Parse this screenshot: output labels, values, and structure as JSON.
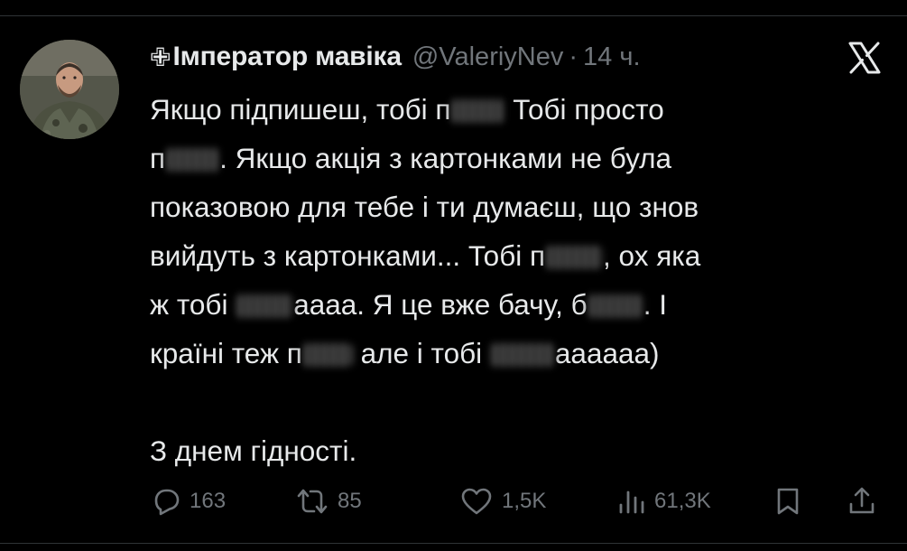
{
  "author": {
    "display_name": "Імператор мавіка",
    "badge_icon": "cross-icon",
    "handle": "@ValeriyNev",
    "separator": "·",
    "time": "14 ч."
  },
  "platform_logo": "x-logo-icon",
  "tweet": {
    "lines": [
      [
        "Якщо підпишеш, тобі п",
        "[blur]",
        " Тобі просто"
      ],
      [
        "п",
        "[blur]",
        ". Якщо акція з картонками не була"
      ],
      [
        "показовою для тебе і ти думаєш, що знов"
      ],
      [
        "вийдуть з картонками... Тобі п",
        "[blur]",
        ", ох яка"
      ],
      [
        "ж тобі ",
        "[blur]",
        "аааа. Я це вже бачу, б",
        "[blur]",
        ". І"
      ],
      [
        "країні теж п",
        "[blur]",
        " але і тобі ",
        "[blur]",
        "аааааа)"
      ],
      [],
      [
        "З днем гідності."
      ]
    ]
  },
  "actions": {
    "replies": {
      "icon": "reply-icon",
      "count": "163"
    },
    "reposts": {
      "icon": "repost-icon",
      "count": "85"
    },
    "likes": {
      "icon": "like-icon",
      "count": "1,5K"
    },
    "views": {
      "icon": "views-icon",
      "count": "61,3K"
    },
    "bookmark": {
      "icon": "bookmark-icon"
    },
    "share": {
      "icon": "share-icon"
    }
  },
  "colors": {
    "background": "#000000",
    "text": "#e7e9ea",
    "secondary": "#71767b",
    "divider": "#2f3336"
  }
}
